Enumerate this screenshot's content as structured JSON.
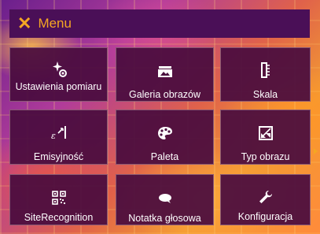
{
  "header": {
    "close_icon": "close-x-icon",
    "title": "Menu",
    "accent": "#f5a623"
  },
  "tiles": [
    {
      "label": "Ustawienia pomiaru",
      "icon": "measurement-settings-icon"
    },
    {
      "label": "Galeria obrazów",
      "icon": "image-gallery-icon"
    },
    {
      "label": "Skala",
      "icon": "scale-icon"
    },
    {
      "label": "Emisyjność",
      "icon": "emissivity-icon"
    },
    {
      "label": "Paleta",
      "icon": "palette-icon"
    },
    {
      "label": "Typ obrazu",
      "icon": "image-type-icon"
    },
    {
      "label": "SiteRecognition",
      "icon": "qr-code-icon"
    },
    {
      "label": "Notatka głosowa",
      "icon": "voice-note-icon"
    },
    {
      "label": "Konfiguracja",
      "icon": "wrench-icon"
    }
  ]
}
